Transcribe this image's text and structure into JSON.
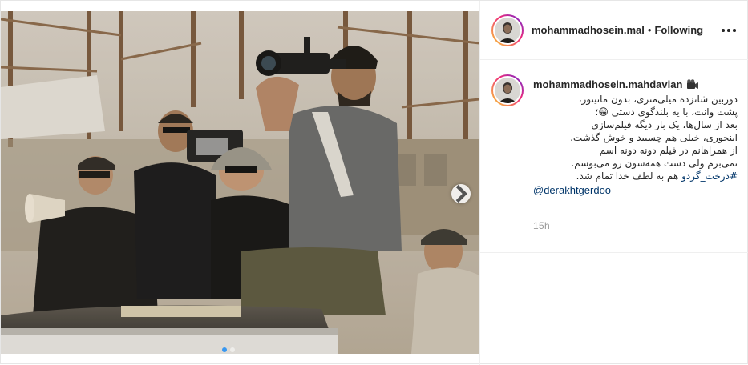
{
  "post": {
    "header": {
      "username": "mohammadhosein.mal",
      "separator": "•",
      "follow_label": "Following",
      "avatar_icon": "profile-photo",
      "more_icon": "more-options-icon"
    },
    "caption": {
      "username": "mohammadhosein.mahdavian",
      "emoji_icon": "movie-camera-icon",
      "lines": [
        "دوربین شانزده میلی‌متری، بدون مانیتور،",
        "پشت وانت، با یه بلندگوی دستی 😁؛",
        "بعد از سال‌ها، یک بار دیگه فیلم‌سازی",
        "اینجوری، خیلی هم چسبید و خوش گذشت.",
        "از همراهانم در فیلم دونه دونه اسم",
        "نمی‌برم ولی دست همه‌شون رو می‌بوسم."
      ],
      "last_line_before_hashtag": "هم به لطف خدا تمام شد.",
      "hashtag": "#درخت_گردو",
      "mention": "@derakhtgerdoo"
    },
    "timestamp": "15h",
    "carousel": {
      "next_icon": "chevron-right-icon",
      "slide_count": 2,
      "active_index": 0
    }
  }
}
